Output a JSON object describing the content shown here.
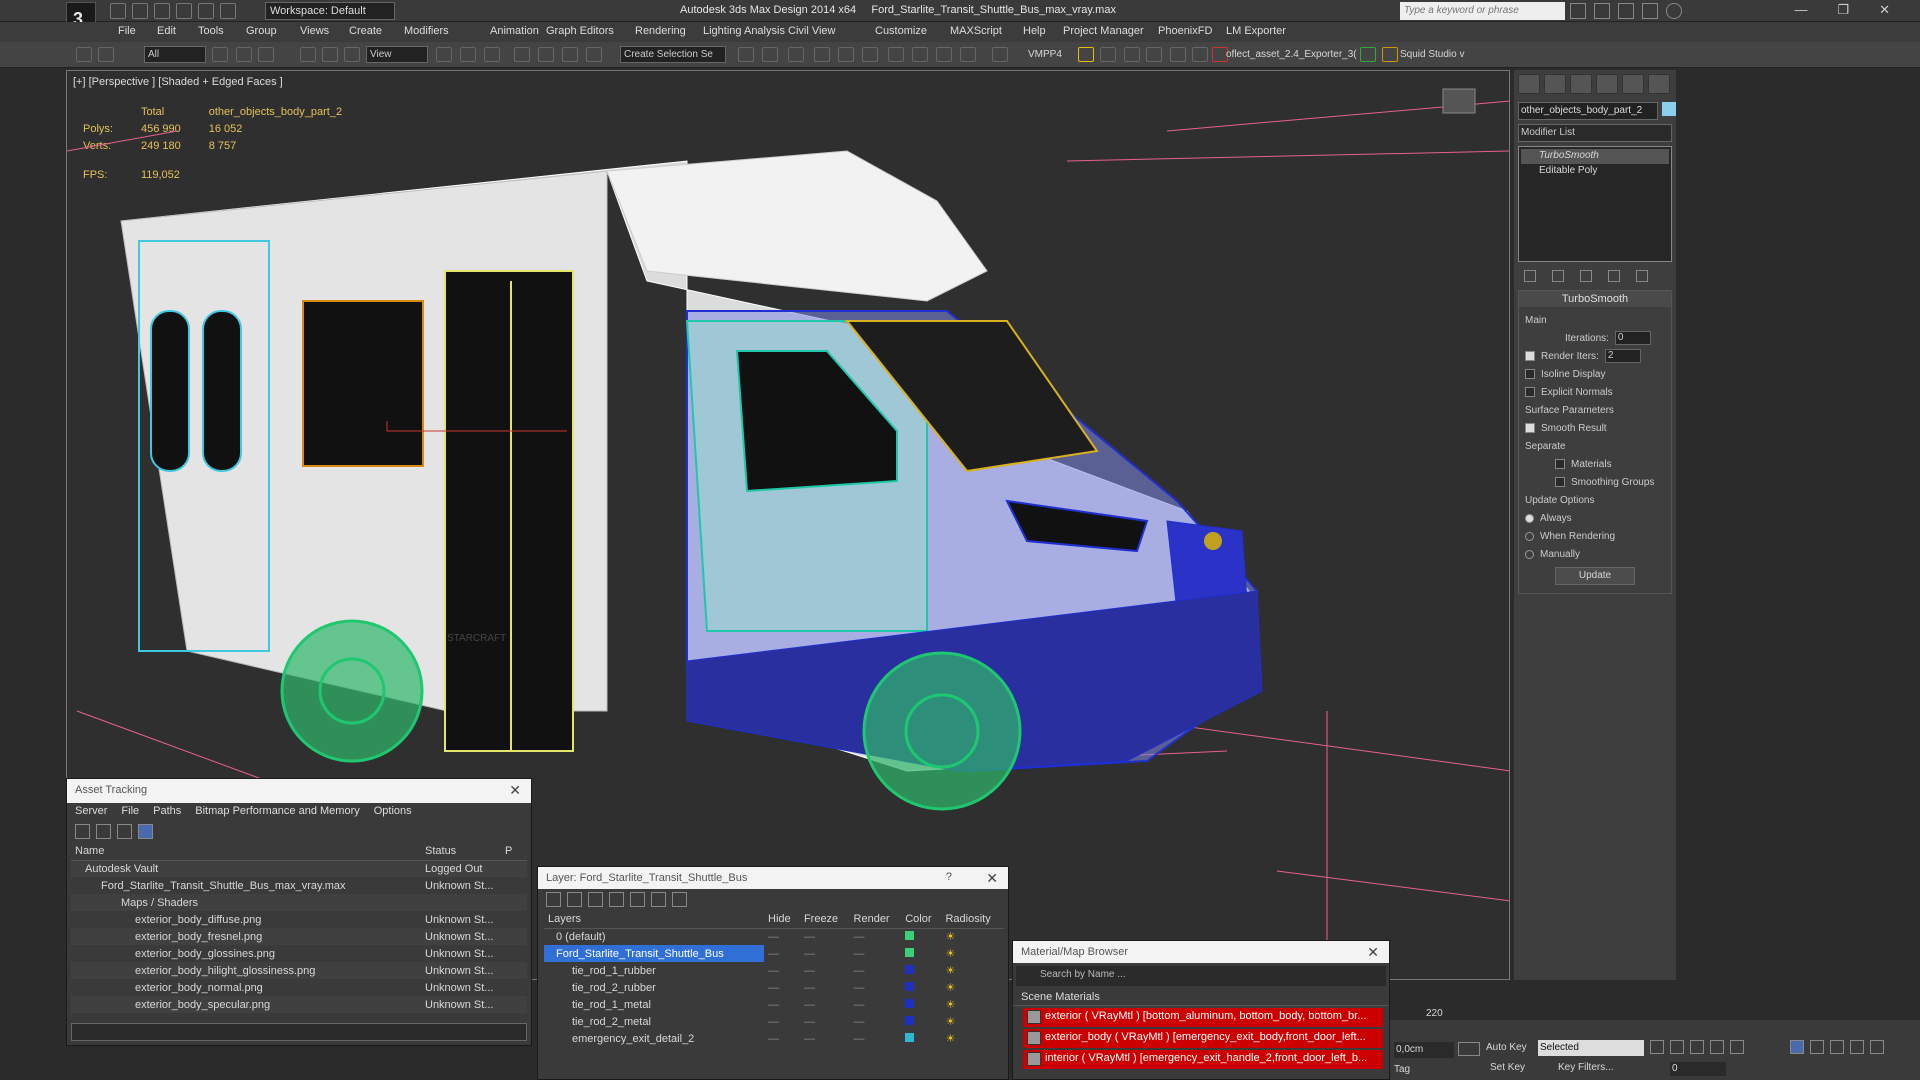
{
  "titlebar": {
    "app_title": "Autodesk 3ds Max Design 2014 x64",
    "file_title": "Ford_Starlite_Transit_Shuttle_Bus_max_vray.max",
    "workspace": "Workspace: Default",
    "search_placeholder": "Type a keyword or phrase"
  },
  "menubar": [
    "File",
    "Edit",
    "Tools",
    "Group",
    "Views",
    "Create",
    "Modifiers",
    "Animation",
    "Graph Editors",
    "Rendering",
    "Lighting Analysis",
    "Civil View",
    "Customize",
    "MAXScript",
    "Help",
    "Project Manager",
    "PhoenixFD",
    "LM Exporter"
  ],
  "toolbar": {
    "filter": "All",
    "ref_coord": "View",
    "selection_set": "Create Selection Se",
    "vmpp": "VMPP4",
    "exporter": "oflect_asset_2.4_Exporter_3(",
    "squid": "Squid Studio v"
  },
  "viewport": {
    "label": "[+] [Perspective ] [Shaded + Edged Faces ]",
    "stats": {
      "total_label": "Total",
      "object_label": "other_objects_body_part_2",
      "polys_label": "Polys:",
      "polys_total": "456 990",
      "polys_obj": "16 052",
      "verts_label": "Verts:",
      "verts_total": "249 180",
      "verts_obj": "8 757",
      "fps_label": "FPS:",
      "fps": "119,052"
    },
    "van_badge": "STARCRAFT"
  },
  "command_panel": {
    "object_name": "other_objects_body_part_2",
    "object_color": "#8ad0ee",
    "modifier_list": "Modifier List",
    "stack": [
      "TurboSmooth",
      "Editable Poly"
    ],
    "rollout_title": "TurboSmooth",
    "main_label": "Main",
    "iterations_label": "Iterations:",
    "iterations": "0",
    "render_iters_label": "Render Iters:",
    "render_iters": "2",
    "isoline": "Isoline Display",
    "explicit": "Explicit Normals",
    "surface_params": "Surface Parameters",
    "smooth_result": "Smooth Result",
    "separate": "Separate",
    "materials": "Materials",
    "smoothing_groups": "Smoothing Groups",
    "update_options": "Update Options",
    "always": "Always",
    "when_rendering": "When Rendering",
    "manually": "Manually",
    "update_btn": "Update"
  },
  "asset_tracking": {
    "title": "Asset Tracking",
    "menu": [
      "Server",
      "File",
      "Paths",
      "Bitmap Performance and Memory",
      "Options"
    ],
    "col_name": "Name",
    "col_status": "Status",
    "col_p": "P",
    "rows": [
      {
        "name": "Autodesk Vault",
        "status": "Logged Out"
      },
      {
        "name": "Ford_Starlite_Transit_Shuttle_Bus_max_vray.max",
        "status": "Unknown St..."
      },
      {
        "name": "Maps / Shaders",
        "status": ""
      },
      {
        "name": "exterior_body_diffuse.png",
        "status": "Unknown St..."
      },
      {
        "name": "exterior_body_fresnel.png",
        "status": "Unknown St..."
      },
      {
        "name": "exterior_body_glossines.png",
        "status": "Unknown St..."
      },
      {
        "name": "exterior_body_hilight_glossiness.png",
        "status": "Unknown St..."
      },
      {
        "name": "exterior_body_normal.png",
        "status": "Unknown St..."
      },
      {
        "name": "exterior_body_specular.png",
        "status": "Unknown St..."
      }
    ]
  },
  "layers": {
    "title": "Layer: Ford_Starlite_Transit_Shuttle_Bus",
    "help": "?",
    "cols": [
      "Layers",
      "Hide",
      "Freeze",
      "Render",
      "Color",
      "Radiosity"
    ],
    "rows": [
      {
        "name": "0 (default)",
        "color": "#3ad07a"
      },
      {
        "name": "Ford_Starlite_Transit_Shuttle_Bus",
        "color": "#3ad07a",
        "selected": true
      },
      {
        "name": "tie_rod_1_rubber",
        "color": "#2030c0"
      },
      {
        "name": "tie_rod_2_rubber",
        "color": "#2030c0"
      },
      {
        "name": "tie_rod_1_metal",
        "color": "#2030c0"
      },
      {
        "name": "tie_rod_2_metal",
        "color": "#2030c0"
      },
      {
        "name": "emergency_exit_detail_2",
        "color": "#30b8d0"
      }
    ]
  },
  "material_browser": {
    "title": "Material/Map Browser",
    "search_placeholder": "Search by Name ...",
    "group": "Scene Materials",
    "items": [
      "exterior  ( VRayMtl ) [bottom_aluminum, bottom_body, bottom_br...",
      "exterior_body  ( VRayMtl ) [emergency_exit_body,front_door_left...",
      "interior  ( VRayMtl ) [emergency_exit_handle_2,front_door_left_b..."
    ]
  },
  "status": {
    "timeline_tick": "220",
    "coord": "0,0cm",
    "auto_key": "Auto Key",
    "set_key": "Set Key",
    "selected": "Selected",
    "key_filters": "Key Filters...",
    "frame": "0",
    "add_tag": "Tag"
  }
}
